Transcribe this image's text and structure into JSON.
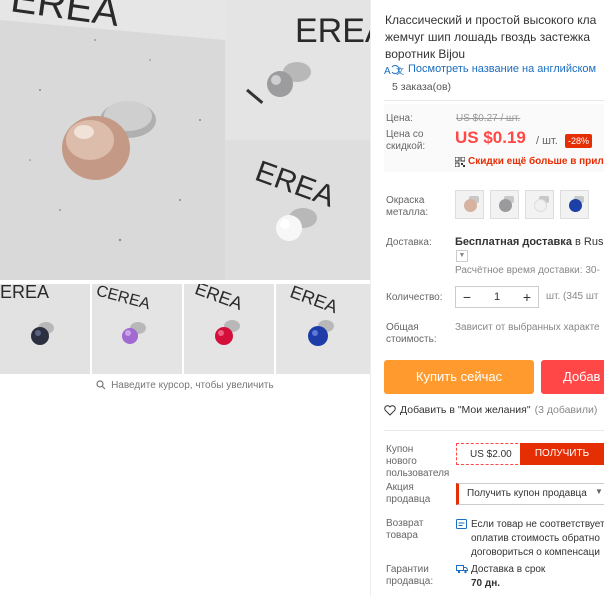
{
  "gallery": {
    "zoom_hint": "Наведите курсор, чтобы увеличить",
    "watermark_main": "EREA",
    "watermark_small": "CEREA"
  },
  "product": {
    "title_lines": [
      "Классический и простой высокого кла",
      "жемчуг шип лошадь гвоздь застежка",
      "воротник Bijou"
    ],
    "translate_link": "Посмотреть название на английском",
    "orders": "5 заказа(ов)"
  },
  "price": {
    "label_price": "Цена:",
    "old_price": "US $0.27 / шт.",
    "label_discount": "Цена со скидкой:",
    "new_price": "US $0.19",
    "unit": "/ шт.",
    "discount": "-28%",
    "promo": "Скидки ещё больше в прило"
  },
  "options": {
    "label_color": "Окраска металла:",
    "swatch_colors": [
      "#d7b2a0",
      "#9a9a9c",
      "#f0f0f0",
      "#1d3fa8"
    ]
  },
  "shipping": {
    "label": "Доставка:",
    "value_bold": "Бесплатная доставка",
    "value_rest": " в Russia",
    "estimate": "Расчётное время доставки: 30-"
  },
  "quantity": {
    "label": "Количество:",
    "minus": "−",
    "value": "1",
    "plus": "+",
    "available": "шт. (345 шт"
  },
  "total": {
    "label": "Общая стоимость:",
    "value": "Зависит от выбранных характе"
  },
  "actions": {
    "buy_now": "Купить сейчас",
    "add_to_cart": "Добав",
    "wishlist": "Добавить в \"Мои желания\"",
    "wishlist_count": "(3 добавили)"
  },
  "coupon": {
    "label": "Купон нового пользователя",
    "amount": "US $2.00",
    "get": "ПОЛУЧИТЬ"
  },
  "seller_promo": {
    "label": "Акция продавца",
    "select": "Получить купон продавца"
  },
  "returns": {
    "label": "Возврат товара",
    "lines": [
      "Если товар не соответствует",
      "оплатив стоимость обратно",
      "договориться о компенсаци"
    ]
  },
  "guarantee": {
    "label": "Гарантии продавца:",
    "line1": "Доставка в срок",
    "line2": "70 дн."
  }
}
